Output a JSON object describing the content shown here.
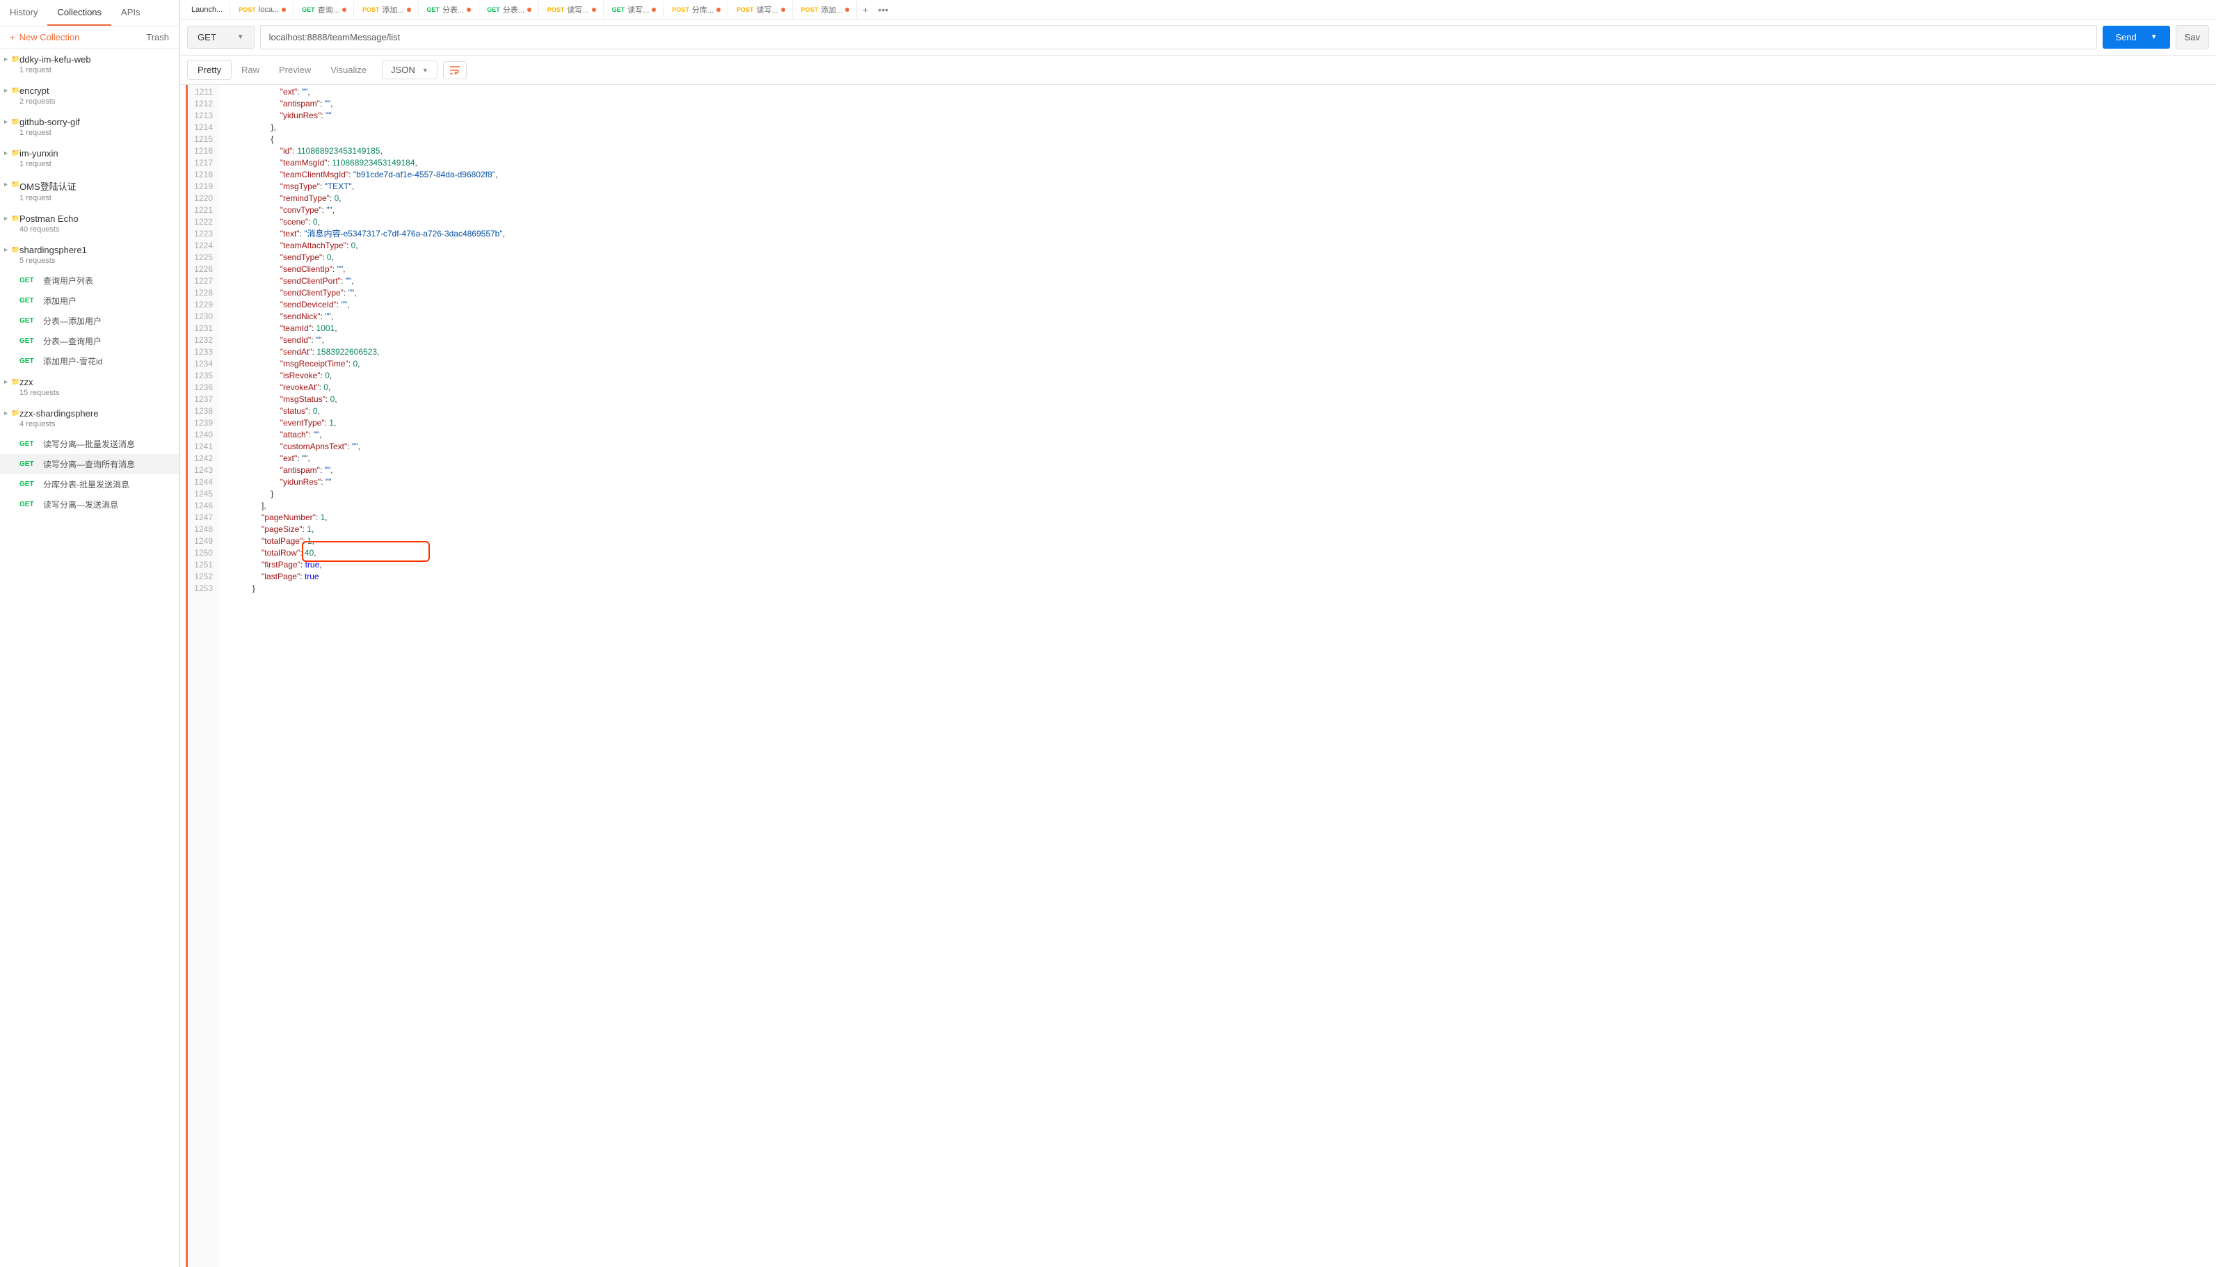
{
  "sidebar": {
    "tabs": {
      "history": "History",
      "collections": "Collections",
      "apis": "APIs"
    },
    "newCollection": "New Collection",
    "trash": "Trash",
    "collections": [
      {
        "name": "ddky-im-kefu-web",
        "sub": "1 request"
      },
      {
        "name": "encrypt",
        "sub": "2 requests"
      },
      {
        "name": "github-sorry-gif",
        "sub": "1 request"
      },
      {
        "name": "im-yunxin",
        "sub": "1 request"
      },
      {
        "name": "OMS登陆认证",
        "sub": "1 request"
      },
      {
        "name": "Postman Echo",
        "sub": "40 requests"
      },
      {
        "name": "shardingsphere1",
        "sub": "5 requests"
      }
    ],
    "requests1": [
      {
        "m": "GET",
        "n": "查询用户列表"
      },
      {
        "m": "GET",
        "n": "添加用户"
      },
      {
        "m": "GET",
        "n": "分表—添加用户"
      },
      {
        "m": "GET",
        "n": "分表—查询用户"
      },
      {
        "m": "GET",
        "n": "添加用户-雪花id"
      }
    ],
    "coll2": {
      "name": "zzx",
      "sub": "15 requests"
    },
    "coll3": {
      "name": "zzx-shardingsphere",
      "sub": "4 requests"
    },
    "requests2": [
      {
        "m": "GET",
        "n": "读写分离—批量发送消息"
      },
      {
        "m": "GET",
        "n": "读写分离—查询所有消息"
      },
      {
        "m": "GET",
        "n": "分库分表-批量发送消息"
      },
      {
        "m": "GET",
        "n": "读写分离—发送消息"
      }
    ]
  },
  "tabs": [
    {
      "m": "",
      "cls": "",
      "label": "Launch..."
    },
    {
      "m": "POST",
      "cls": "post",
      "label": "loca..."
    },
    {
      "m": "GET",
      "cls": "get",
      "label": "查询..."
    },
    {
      "m": "POST",
      "cls": "post",
      "label": "添加..."
    },
    {
      "m": "GET",
      "cls": "get",
      "label": "分表..."
    },
    {
      "m": "GET",
      "cls": "get",
      "label": "分表..."
    },
    {
      "m": "POST",
      "cls": "post",
      "label": "读写..."
    },
    {
      "m": "GET",
      "cls": "get",
      "label": "读写..."
    },
    {
      "m": "POST",
      "cls": "post",
      "label": "分库..."
    },
    {
      "m": "POST",
      "cls": "post",
      "label": "读写..."
    },
    {
      "m": "POST",
      "cls": "post",
      "label": "添加..."
    }
  ],
  "reqBar": {
    "method": "GET",
    "url": "localhost:8888/teamMessage/list",
    "send": "Send",
    "save": "Sav"
  },
  "respTabs": {
    "pretty": "Pretty",
    "raw": "Raw",
    "preview": "Preview",
    "visualize": "Visualize",
    "format": "JSON"
  },
  "code": {
    "startLine": 1211,
    "lines": [
      [
        [
          "i",
          26
        ],
        [
          "k",
          "\"ext\""
        ],
        [
          "p",
          ": "
        ],
        [
          "s",
          "\"\""
        ],
        [
          "p",
          ","
        ]
      ],
      [
        [
          "i",
          26
        ],
        [
          "k",
          "\"antispam\""
        ],
        [
          "p",
          ": "
        ],
        [
          "s",
          "\"\""
        ],
        [
          "p",
          ","
        ]
      ],
      [
        [
          "i",
          26
        ],
        [
          "k",
          "\"yidunRes\""
        ],
        [
          "p",
          ": "
        ],
        [
          "s",
          "\"\""
        ]
      ],
      [
        [
          "i",
          22
        ],
        [
          "p",
          "},"
        ]
      ],
      [
        [
          "i",
          22
        ],
        [
          "p",
          "{"
        ]
      ],
      [
        [
          "i",
          26
        ],
        [
          "k",
          "\"id\""
        ],
        [
          "p",
          ": "
        ],
        [
          "n",
          "110868923453149185"
        ],
        [
          "p",
          ","
        ]
      ],
      [
        [
          "i",
          26
        ],
        [
          "k",
          "\"teamMsgId\""
        ],
        [
          "p",
          ": "
        ],
        [
          "n",
          "110868923453149184"
        ],
        [
          "p",
          ","
        ]
      ],
      [
        [
          "i",
          26
        ],
        [
          "k",
          "\"teamClientMsgId\""
        ],
        [
          "p",
          ": "
        ],
        [
          "s",
          "\"b91cde7d-af1e-4557-84da-d96802f8\""
        ],
        [
          "p",
          ","
        ]
      ],
      [
        [
          "i",
          26
        ],
        [
          "k",
          "\"msgType\""
        ],
        [
          "p",
          ": "
        ],
        [
          "s",
          "\"TEXT\""
        ],
        [
          "p",
          ","
        ]
      ],
      [
        [
          "i",
          26
        ],
        [
          "k",
          "\"remindType\""
        ],
        [
          "p",
          ": "
        ],
        [
          "n",
          "0"
        ],
        [
          "p",
          ","
        ]
      ],
      [
        [
          "i",
          26
        ],
        [
          "k",
          "\"convType\""
        ],
        [
          "p",
          ": "
        ],
        [
          "s",
          "\"\""
        ],
        [
          "p",
          ","
        ]
      ],
      [
        [
          "i",
          26
        ],
        [
          "k",
          "\"scene\""
        ],
        [
          "p",
          ": "
        ],
        [
          "n",
          "0"
        ],
        [
          "p",
          ","
        ]
      ],
      [
        [
          "i",
          26
        ],
        [
          "k",
          "\"text\""
        ],
        [
          "p",
          ": "
        ],
        [
          "s",
          "\"消息内容-e5347317-c7df-476a-a726-3dac4869557b\""
        ],
        [
          "p",
          ","
        ]
      ],
      [
        [
          "i",
          26
        ],
        [
          "k",
          "\"teamAttachType\""
        ],
        [
          "p",
          ": "
        ],
        [
          "n",
          "0"
        ],
        [
          "p",
          ","
        ]
      ],
      [
        [
          "i",
          26
        ],
        [
          "k",
          "\"sendType\""
        ],
        [
          "p",
          ": "
        ],
        [
          "n",
          "0"
        ],
        [
          "p",
          ","
        ]
      ],
      [
        [
          "i",
          26
        ],
        [
          "k",
          "\"sendClientIp\""
        ],
        [
          "p",
          ": "
        ],
        [
          "s",
          "\"\""
        ],
        [
          "p",
          ","
        ]
      ],
      [
        [
          "i",
          26
        ],
        [
          "k",
          "\"sendClientPort\""
        ],
        [
          "p",
          ": "
        ],
        [
          "s",
          "\"\""
        ],
        [
          "p",
          ","
        ]
      ],
      [
        [
          "i",
          26
        ],
        [
          "k",
          "\"sendClientType\""
        ],
        [
          "p",
          ": "
        ],
        [
          "s",
          "\"\""
        ],
        [
          "p",
          ","
        ]
      ],
      [
        [
          "i",
          26
        ],
        [
          "k",
          "\"sendDeviceId\""
        ],
        [
          "p",
          ": "
        ],
        [
          "s",
          "\"\""
        ],
        [
          "p",
          ","
        ]
      ],
      [
        [
          "i",
          26
        ],
        [
          "k",
          "\"sendNick\""
        ],
        [
          "p",
          ": "
        ],
        [
          "s",
          "\"\""
        ],
        [
          "p",
          ","
        ]
      ],
      [
        [
          "i",
          26
        ],
        [
          "k",
          "\"teamId\""
        ],
        [
          "p",
          ": "
        ],
        [
          "n",
          "1001"
        ],
        [
          "p",
          ","
        ]
      ],
      [
        [
          "i",
          26
        ],
        [
          "k",
          "\"sendId\""
        ],
        [
          "p",
          ": "
        ],
        [
          "s",
          "\"\""
        ],
        [
          "p",
          ","
        ]
      ],
      [
        [
          "i",
          26
        ],
        [
          "k",
          "\"sendAt\""
        ],
        [
          "p",
          ": "
        ],
        [
          "n",
          "1583922606523"
        ],
        [
          "p",
          ","
        ]
      ],
      [
        [
          "i",
          26
        ],
        [
          "k",
          "\"msgReceiptTime\""
        ],
        [
          "p",
          ": "
        ],
        [
          "n",
          "0"
        ],
        [
          "p",
          ","
        ]
      ],
      [
        [
          "i",
          26
        ],
        [
          "k",
          "\"isRevoke\""
        ],
        [
          "p",
          ": "
        ],
        [
          "n",
          "0"
        ],
        [
          "p",
          ","
        ]
      ],
      [
        [
          "i",
          26
        ],
        [
          "k",
          "\"revokeAt\""
        ],
        [
          "p",
          ": "
        ],
        [
          "n",
          "0"
        ],
        [
          "p",
          ","
        ]
      ],
      [
        [
          "i",
          26
        ],
        [
          "k",
          "\"msgStatus\""
        ],
        [
          "p",
          ": "
        ],
        [
          "n",
          "0"
        ],
        [
          "p",
          ","
        ]
      ],
      [
        [
          "i",
          26
        ],
        [
          "k",
          "\"status\""
        ],
        [
          "p",
          ": "
        ],
        [
          "n",
          "0"
        ],
        [
          "p",
          ","
        ]
      ],
      [
        [
          "i",
          26
        ],
        [
          "k",
          "\"eventType\""
        ],
        [
          "p",
          ": "
        ],
        [
          "n",
          "1"
        ],
        [
          "p",
          ","
        ]
      ],
      [
        [
          "i",
          26
        ],
        [
          "k",
          "\"attach\""
        ],
        [
          "p",
          ": "
        ],
        [
          "s",
          "\"\""
        ],
        [
          "p",
          ","
        ]
      ],
      [
        [
          "i",
          26
        ],
        [
          "k",
          "\"customApnsText\""
        ],
        [
          "p",
          ": "
        ],
        [
          "s",
          "\"\""
        ],
        [
          "p",
          ","
        ]
      ],
      [
        [
          "i",
          26
        ],
        [
          "k",
          "\"ext\""
        ],
        [
          "p",
          ": "
        ],
        [
          "s",
          "\"\""
        ],
        [
          "p",
          ","
        ]
      ],
      [
        [
          "i",
          26
        ],
        [
          "k",
          "\"antispam\""
        ],
        [
          "p",
          ": "
        ],
        [
          "s",
          "\"\""
        ],
        [
          "p",
          ","
        ]
      ],
      [
        [
          "i",
          26
        ],
        [
          "k",
          "\"yidunRes\""
        ],
        [
          "p",
          ": "
        ],
        [
          "s",
          "\"\""
        ]
      ],
      [
        [
          "i",
          22
        ],
        [
          "p",
          "}"
        ]
      ],
      [
        [
          "i",
          18
        ],
        [
          "p",
          "],"
        ]
      ],
      [
        [
          "i",
          18
        ],
        [
          "k",
          "\"pageNumber\""
        ],
        [
          "p",
          ": "
        ],
        [
          "n",
          "1"
        ],
        [
          "p",
          ","
        ]
      ],
      [
        [
          "i",
          18
        ],
        [
          "k",
          "\"pageSize\""
        ],
        [
          "p",
          ": "
        ],
        [
          "n",
          "1"
        ],
        [
          "p",
          ","
        ]
      ],
      [
        [
          "i",
          18
        ],
        [
          "k",
          "\"totalPage\""
        ],
        [
          "p",
          ": "
        ],
        [
          "n",
          "1"
        ],
        [
          "p",
          ","
        ]
      ],
      [
        [
          "i",
          18
        ],
        [
          "k",
          "\"totalRow\""
        ],
        [
          "p",
          ": "
        ],
        [
          "n",
          "40"
        ],
        [
          "p",
          ","
        ]
      ],
      [
        [
          "i",
          18
        ],
        [
          "k",
          "\"firstPage\""
        ],
        [
          "p",
          ": "
        ],
        [
          "b",
          "true"
        ],
        [
          "p",
          ","
        ]
      ],
      [
        [
          "i",
          18
        ],
        [
          "k",
          "\"lastPage\""
        ],
        [
          "p",
          ": "
        ],
        [
          "b",
          "true"
        ]
      ],
      [
        [
          "i",
          14
        ],
        [
          "p",
          "}"
        ]
      ]
    ],
    "highlightLine": 39
  }
}
